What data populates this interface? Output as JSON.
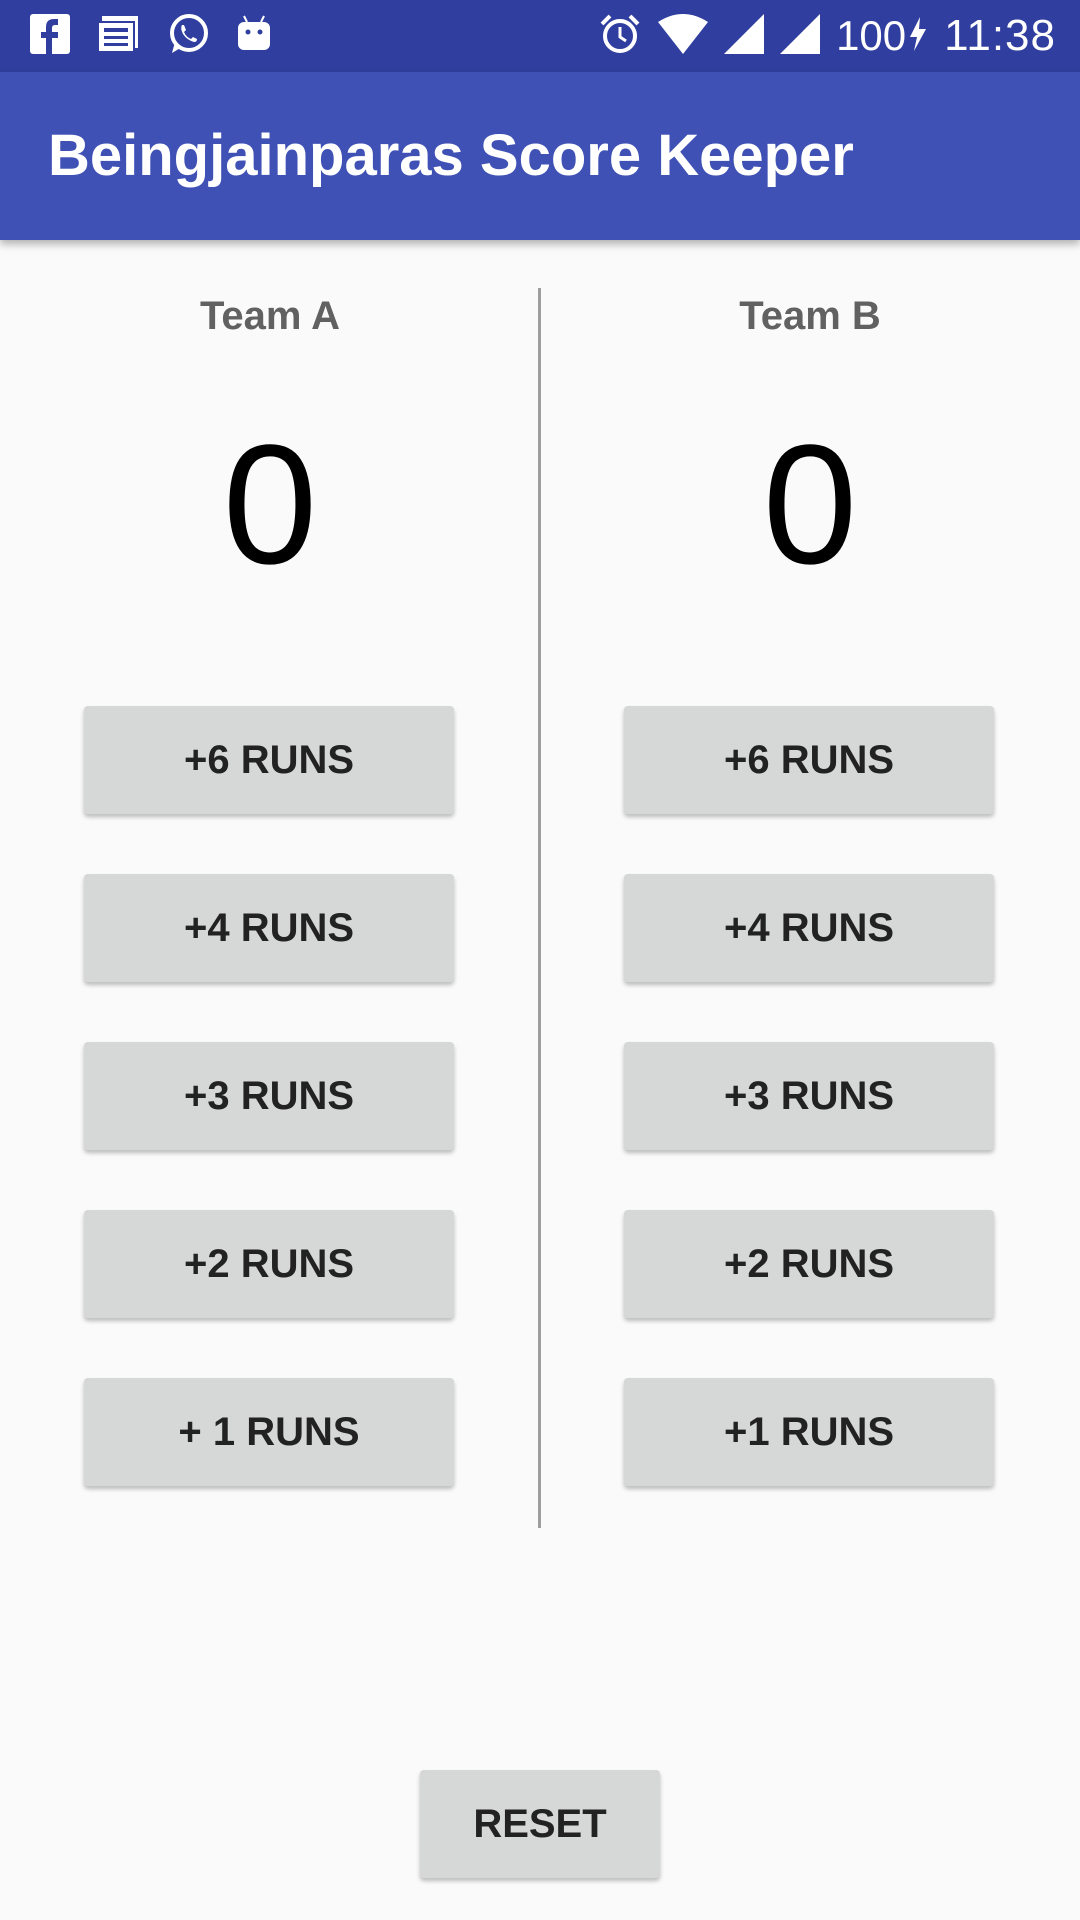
{
  "status_bar": {
    "left_icons": [
      "facebook-icon",
      "news-icon",
      "whatsapp-icon",
      "android-icon"
    ],
    "right_icons": [
      "alarm-icon",
      "wifi-icon",
      "cell-signal-icon",
      "cell-signal-2-icon",
      "battery-charging-icon"
    ],
    "battery": "100",
    "time": "11:38"
  },
  "app_bar": {
    "title": "Beingjainparas Score Keeper",
    "color": "#3f51b5"
  },
  "team_a": {
    "name": "Team A",
    "score": "0",
    "buttons": [
      "+6 RUNS",
      "+4 RUNS",
      "+3 RUNS",
      "+2 RUNS",
      "+ 1 RUNS"
    ]
  },
  "team_b": {
    "name": "Team B",
    "score": "0",
    "buttons": [
      "+6 RUNS",
      "+4 RUNS",
      "+3 RUNS",
      "+2 RUNS",
      "+1 RUNS"
    ]
  },
  "reset_label": "RESET"
}
